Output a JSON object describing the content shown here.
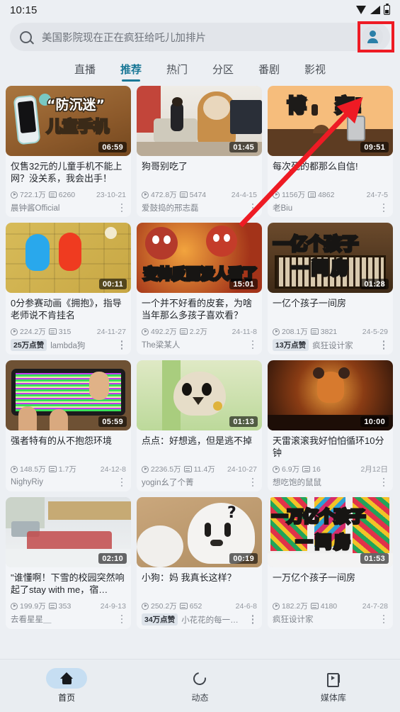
{
  "status": {
    "time": "10:15",
    "icons": [
      "wifi-icon",
      "signal-icon",
      "battery-icon"
    ]
  },
  "search": {
    "query": "美国影院现在正在疯狂给吒儿加排片",
    "icon": "search-icon",
    "avatar_label": "account-avatar"
  },
  "tabs": [
    {
      "label": "直播",
      "active": false
    },
    {
      "label": "推荐",
      "active": true
    },
    {
      "label": "热门",
      "active": false
    },
    {
      "label": "分区",
      "active": false
    },
    {
      "label": "番剧",
      "active": false
    },
    {
      "label": "影视",
      "active": false
    }
  ],
  "accent": "#1a7897",
  "highlight_color": "#ee1b24",
  "cards": [
    {
      "title": "仅售32元的儿童手机不能上网？没关系，我会出手！",
      "duration": "06:59",
      "views": "722.1万",
      "danmaku": "6260",
      "date": "23-10-21",
      "author": "晨钟酱Official",
      "like_badge": "",
      "thumb_text": [
        "“防沉迷”",
        "儿童手机"
      ]
    },
    {
      "title": "狗哥别吃了",
      "duration": "01:45",
      "views": "472.8万",
      "danmaku": "5474",
      "date": "24-4-15",
      "author": "爱鼓捣的邢志磊",
      "like_badge": "",
      "thumb_text": []
    },
    {
      "title": "每次死的都那么自信!",
      "duration": "09:51",
      "views": "1156万",
      "danmaku": "4862",
      "date": "24-7-5",
      "author": "老Biu",
      "like_badge": "",
      "thumb_text": [
        "博",
        "弈!"
      ]
    },
    {
      "title": "0分参赛动画《拥抱》，指导老师说不肯挂名",
      "duration": "00:11",
      "views": "224.2万",
      "danmaku": "315",
      "date": "24-11-27",
      "author": "lambda狗",
      "like_badge": "25万点赞",
      "thumb_text": []
    },
    {
      "title": "一个并不好看的皮套，为啥当年那么多孩子喜欢看？",
      "duration": "15:01",
      "views": "492.2万",
      "danmaku": "2.2万",
      "date": "24-11-8",
      "author": "The梁某人",
      "like_badge": "",
      "thumb_text": [
        "变帅反而没人看了"
      ]
    },
    {
      "title": "一亿个孩子一间房",
      "duration": "01:28",
      "views": "208.1万",
      "danmaku": "3821",
      "date": "24-5-29",
      "author": "疯狂设计家",
      "like_badge": "13万点赞",
      "thumb_text": [
        "一亿个孩子",
        "一间房"
      ]
    },
    {
      "title": "强者特有的从不抱怨环境",
      "duration": "05:59",
      "views": "148.5万",
      "danmaku": "1.7万",
      "date": "24-12-8",
      "author": "NighyRiy",
      "like_badge": "",
      "thumb_text": []
    },
    {
      "title": "点点：好想逃，但是逃不掉",
      "duration": "01:13",
      "views": "2236.5万",
      "danmaku": "11.4万",
      "date": "24-10-27",
      "author": "yogin幺了个菁",
      "like_badge": "",
      "thumb_text": []
    },
    {
      "title": "天雷滚滚我好怕怕循环10分钟",
      "duration": "10:00",
      "views": "6.9万",
      "danmaku": "16",
      "date": "2月12日",
      "author": "想吃饱的鼠鼠",
      "like_badge": "",
      "thumb_text": []
    },
    {
      "title": "\"谁懂啊！下雪的校园突然响起了stay with me，宿…",
      "duration": "02:10",
      "views": "199.9万",
      "danmaku": "353",
      "date": "24-9-13",
      "author": "去看星星＿",
      "like_badge": "",
      "thumb_text": []
    },
    {
      "title": "小狗：妈 我真长这样？",
      "duration": "00:19",
      "views": "250.2万",
      "danmaku": "652",
      "date": "24-6-8",
      "author": "小花花的每一天＿",
      "like_badge": "34万点赞",
      "thumb_text": [
        "?"
      ]
    },
    {
      "title": "一万亿个孩子一间房",
      "duration": "01:53",
      "views": "182.2万",
      "danmaku": "4180",
      "date": "24-7-28",
      "author": "疯狂设计家",
      "like_badge": "",
      "thumb_text": [
        "一万亿个孩子",
        "一间房"
      ]
    }
  ],
  "bottom_nav": [
    {
      "label": "首页",
      "icon": "home-icon",
      "active": true
    },
    {
      "label": "动态",
      "icon": "dynamic-refresh-icon",
      "active": false
    },
    {
      "label": "媒体库",
      "icon": "media-library-icon",
      "active": false
    }
  ]
}
